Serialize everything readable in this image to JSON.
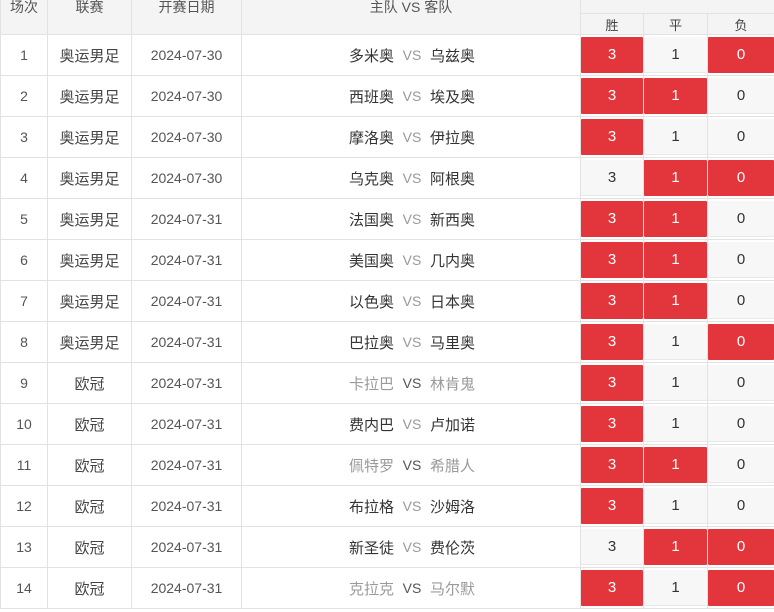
{
  "header": {
    "col_num": "场次",
    "col_league": "联赛",
    "col_date": "开赛日期",
    "col_match": "主队 VS 客队",
    "win": "胜",
    "draw": "平",
    "lose": "负"
  },
  "vs_label": "VS",
  "colors": {
    "selected": "#e2363c",
    "cell": "#f7f7f7",
    "border": "#e2e2e2"
  },
  "rows": [
    {
      "num": "1",
      "league": "奥运男足",
      "date": "2024-07-30",
      "home": "多米奥",
      "away": "乌兹奥",
      "win": "3",
      "draw": "1",
      "lose": "0",
      "sel": [
        true,
        false,
        true
      ],
      "dim": false
    },
    {
      "num": "2",
      "league": "奥运男足",
      "date": "2024-07-30",
      "home": "西班奥",
      "away": "埃及奥",
      "win": "3",
      "draw": "1",
      "lose": "0",
      "sel": [
        true,
        true,
        false
      ],
      "dim": false
    },
    {
      "num": "3",
      "league": "奥运男足",
      "date": "2024-07-30",
      "home": "摩洛奥",
      "away": "伊拉奥",
      "win": "3",
      "draw": "1",
      "lose": "0",
      "sel": [
        true,
        false,
        false
      ],
      "dim": false
    },
    {
      "num": "4",
      "league": "奥运男足",
      "date": "2024-07-30",
      "home": "乌克奥",
      "away": "阿根奥",
      "win": "3",
      "draw": "1",
      "lose": "0",
      "sel": [
        false,
        true,
        true
      ],
      "dim": false
    },
    {
      "num": "5",
      "league": "奥运男足",
      "date": "2024-07-31",
      "home": "法国奥",
      "away": "新西奥",
      "win": "3",
      "draw": "1",
      "lose": "0",
      "sel": [
        true,
        true,
        false
      ],
      "dim": false
    },
    {
      "num": "6",
      "league": "奥运男足",
      "date": "2024-07-31",
      "home": "美国奥",
      "away": "几内奥",
      "win": "3",
      "draw": "1",
      "lose": "0",
      "sel": [
        true,
        true,
        false
      ],
      "dim": false
    },
    {
      "num": "7",
      "league": "奥运男足",
      "date": "2024-07-31",
      "home": "以色奥",
      "away": "日本奥",
      "win": "3",
      "draw": "1",
      "lose": "0",
      "sel": [
        true,
        true,
        false
      ],
      "dim": false
    },
    {
      "num": "8",
      "league": "奥运男足",
      "date": "2024-07-31",
      "home": "巴拉奥",
      "away": "马里奥",
      "win": "3",
      "draw": "1",
      "lose": "0",
      "sel": [
        true,
        false,
        true
      ],
      "dim": false
    },
    {
      "num": "9",
      "league": "欧冠",
      "date": "2024-07-31",
      "home": "卡拉巴",
      "away": "林肯鬼",
      "win": "3",
      "draw": "1",
      "lose": "0",
      "sel": [
        true,
        false,
        false
      ],
      "dim": true
    },
    {
      "num": "10",
      "league": "欧冠",
      "date": "2024-07-31",
      "home": "费内巴",
      "away": "卢加诺",
      "win": "3",
      "draw": "1",
      "lose": "0",
      "sel": [
        true,
        false,
        false
      ],
      "dim": false
    },
    {
      "num": "11",
      "league": "欧冠",
      "date": "2024-07-31",
      "home": "佩特罗",
      "away": "希腊人",
      "win": "3",
      "draw": "1",
      "lose": "0",
      "sel": [
        true,
        true,
        false
      ],
      "dim": true
    },
    {
      "num": "12",
      "league": "欧冠",
      "date": "2024-07-31",
      "home": "布拉格",
      "away": "沙姆洛",
      "win": "3",
      "draw": "1",
      "lose": "0",
      "sel": [
        true,
        false,
        false
      ],
      "dim": false
    },
    {
      "num": "13",
      "league": "欧冠",
      "date": "2024-07-31",
      "home": "新圣徒",
      "away": "费伦茨",
      "win": "3",
      "draw": "1",
      "lose": "0",
      "sel": [
        false,
        true,
        true
      ],
      "dim": false
    },
    {
      "num": "14",
      "league": "欧冠",
      "date": "2024-07-31",
      "home": "克拉克",
      "away": "马尔默",
      "win": "3",
      "draw": "1",
      "lose": "0",
      "sel": [
        true,
        false,
        true
      ],
      "dim": true
    }
  ]
}
